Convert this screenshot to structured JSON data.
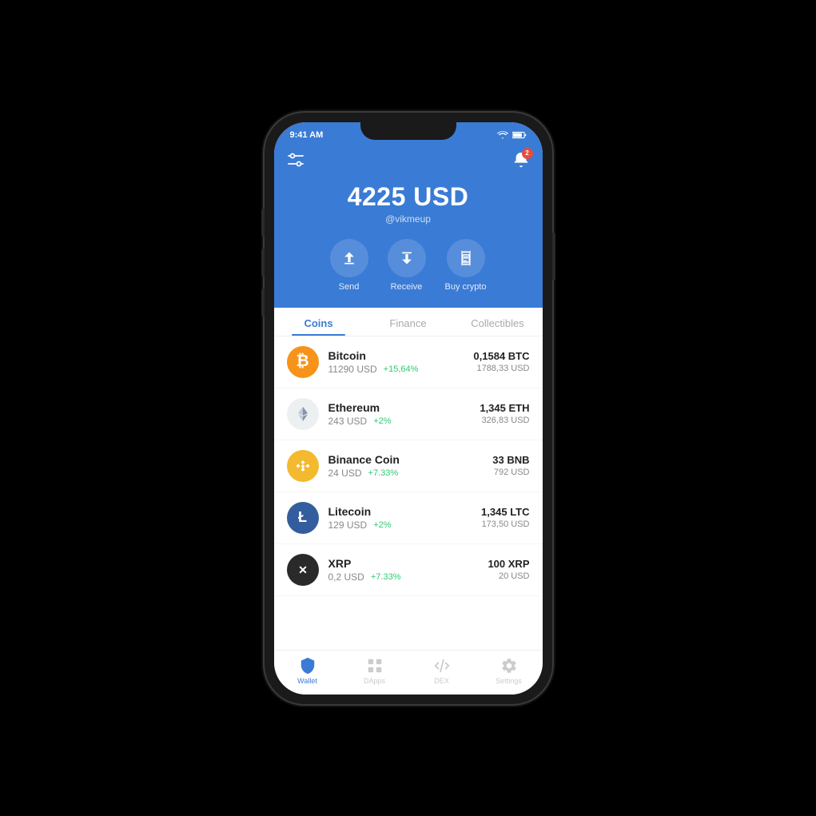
{
  "status_bar": {
    "time": "9:41 AM",
    "notification_count": "2"
  },
  "header": {
    "balance": "4225 USD",
    "username": "@vikmeup",
    "actions": [
      {
        "id": "send",
        "label": "Send",
        "icon": "↑"
      },
      {
        "id": "receive",
        "label": "Receive",
        "icon": "↓"
      },
      {
        "id": "buy_crypto",
        "label": "Buy crypto",
        "icon": "🏷"
      }
    ]
  },
  "tabs": [
    {
      "id": "coins",
      "label": "Coins",
      "active": true
    },
    {
      "id": "finance",
      "label": "Finance",
      "active": false
    },
    {
      "id": "collectibles",
      "label": "Collectibles",
      "active": false
    }
  ],
  "coins": [
    {
      "id": "bitcoin",
      "name": "Bitcoin",
      "price": "11290 USD",
      "change": "+15,64%",
      "amount": "0,1584 BTC",
      "usd_value": "1788,33 USD",
      "icon_color": "#f7931a",
      "icon_text": "₿"
    },
    {
      "id": "ethereum",
      "name": "Ethereum",
      "price": "243 USD",
      "change": "+2%",
      "amount": "1,345 ETH",
      "usd_value": "326,83 USD",
      "icon_color": "#ecf0f1",
      "icon_text": "◆",
      "icon_dark": true
    },
    {
      "id": "binance_coin",
      "name": "Binance Coin",
      "price": "24 USD",
      "change": "+7.33%",
      "amount": "33 BNB",
      "usd_value": "792 USD",
      "icon_color": "#f3ba2f",
      "icon_text": "✦"
    },
    {
      "id": "litecoin",
      "name": "Litecoin",
      "price": "129 USD",
      "change": "+2%",
      "amount": "1,345 LTC",
      "usd_value": "173,50 USD",
      "icon_color": "#345d9d",
      "icon_text": "Ł"
    },
    {
      "id": "xrp",
      "name": "XRP",
      "price": "0,2 USD",
      "change": "+7.33%",
      "amount": "100 XRP",
      "usd_value": "20 USD",
      "icon_color": "#2a2a2a",
      "icon_text": "✕"
    }
  ],
  "bottom_nav": [
    {
      "id": "wallet",
      "label": "Wallet",
      "active": true,
      "icon": "🛡"
    },
    {
      "id": "dapps",
      "label": "DApps",
      "active": false,
      "icon": "⊞"
    },
    {
      "id": "dex",
      "label": "DEX",
      "active": false,
      "icon": "⇄"
    },
    {
      "id": "settings",
      "label": "Settings",
      "active": false,
      "icon": "⚙"
    }
  ]
}
